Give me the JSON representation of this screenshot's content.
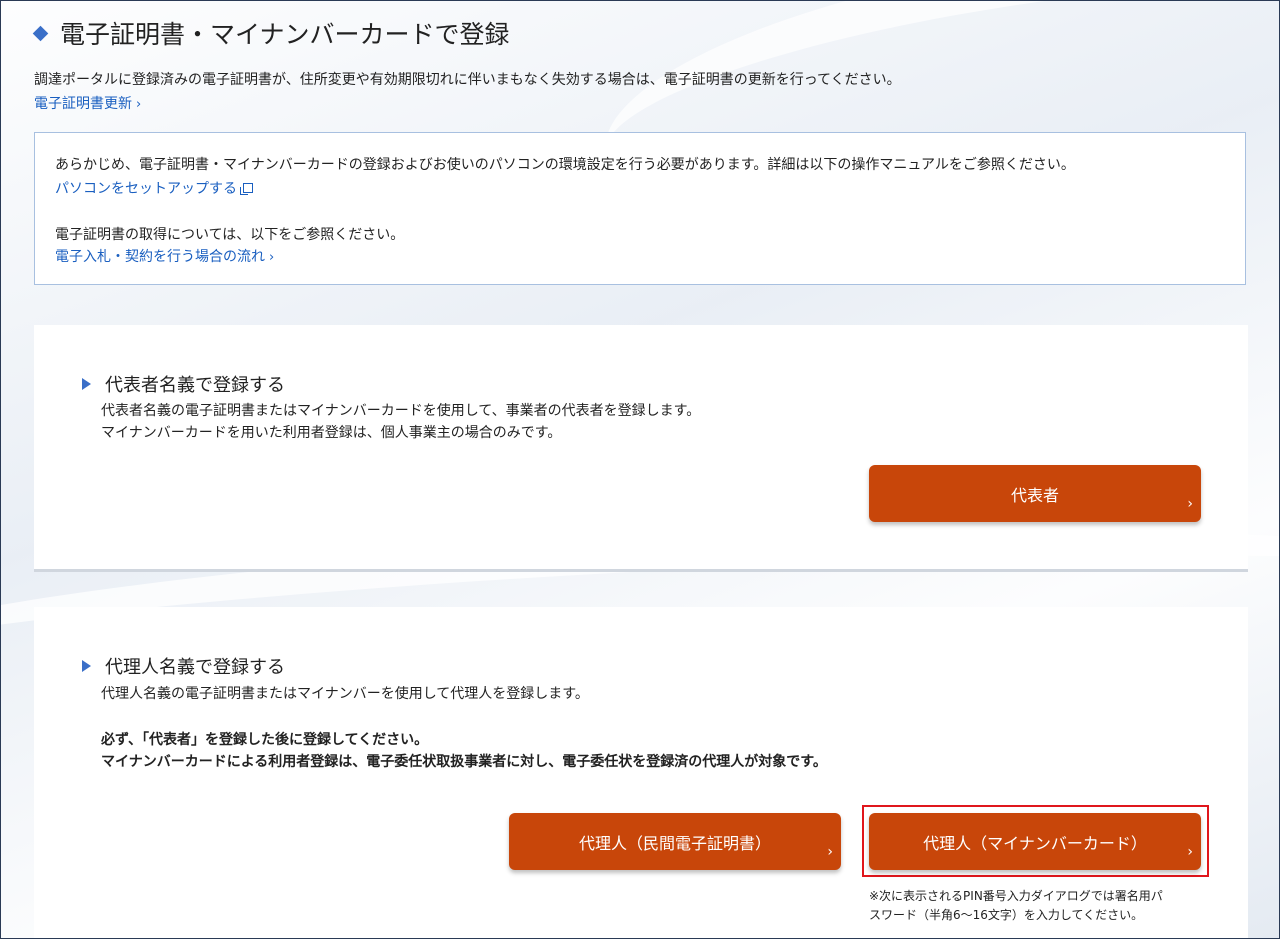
{
  "page": {
    "title": "電子証明書・マイナンバーカードで登録",
    "intro": "調達ポータルに登録済みの電子証明書が、住所変更や有効期限切れに伴いまもなく失効する場合は、電子証明書の更新を行ってください。",
    "intro_link": "電子証明書更新"
  },
  "infobox": {
    "line1": "あらかじめ、電子証明書・マイナンバーカードの登録およびお使いのパソコンの環境設定を行う必要があります。詳細は以下の操作マニュアルをご参照ください。",
    "link1": "パソコンをセットアップする",
    "line2": "電子証明書の取得については、以下をご参照ください。",
    "link2": "電子入札・契約を行う場合の流れ"
  },
  "representative": {
    "heading": "代表者名義で登録する",
    "desc1": "代表者名義の電子証明書またはマイナンバーカードを使用して、事業者の代表者を登録します。",
    "desc2": "マイナンバーカードを用いた利用者登録は、個人事業主の場合のみです。",
    "button": "代表者"
  },
  "agent": {
    "heading": "代理人名義で登録する",
    "desc1": "代理人名義の電子証明書またはマイナンバーを使用して代理人を登録します。",
    "bold1": "必ず、「代表者」を登録した後に登録してください。",
    "bold2": "マイナンバーカードによる利用者登録は、電子委任状取扱事業者に対し、電子委任状を登録済の代理人が対象です。",
    "button_private": "代理人（民間電子証明書）",
    "button_mynumber": "代理人（マイナンバーカード）",
    "note1": "※次に表示されるPIN番号入力ダイアログでは署名用パ",
    "note2": "スワード（半角6～16文字）を入力してください。"
  },
  "icons": {
    "chevron": "›",
    "chevron_small": "〉"
  },
  "colors": {
    "accent": "#c8460a",
    "link": "#1a5fc0",
    "highlight": "#e0161c"
  }
}
